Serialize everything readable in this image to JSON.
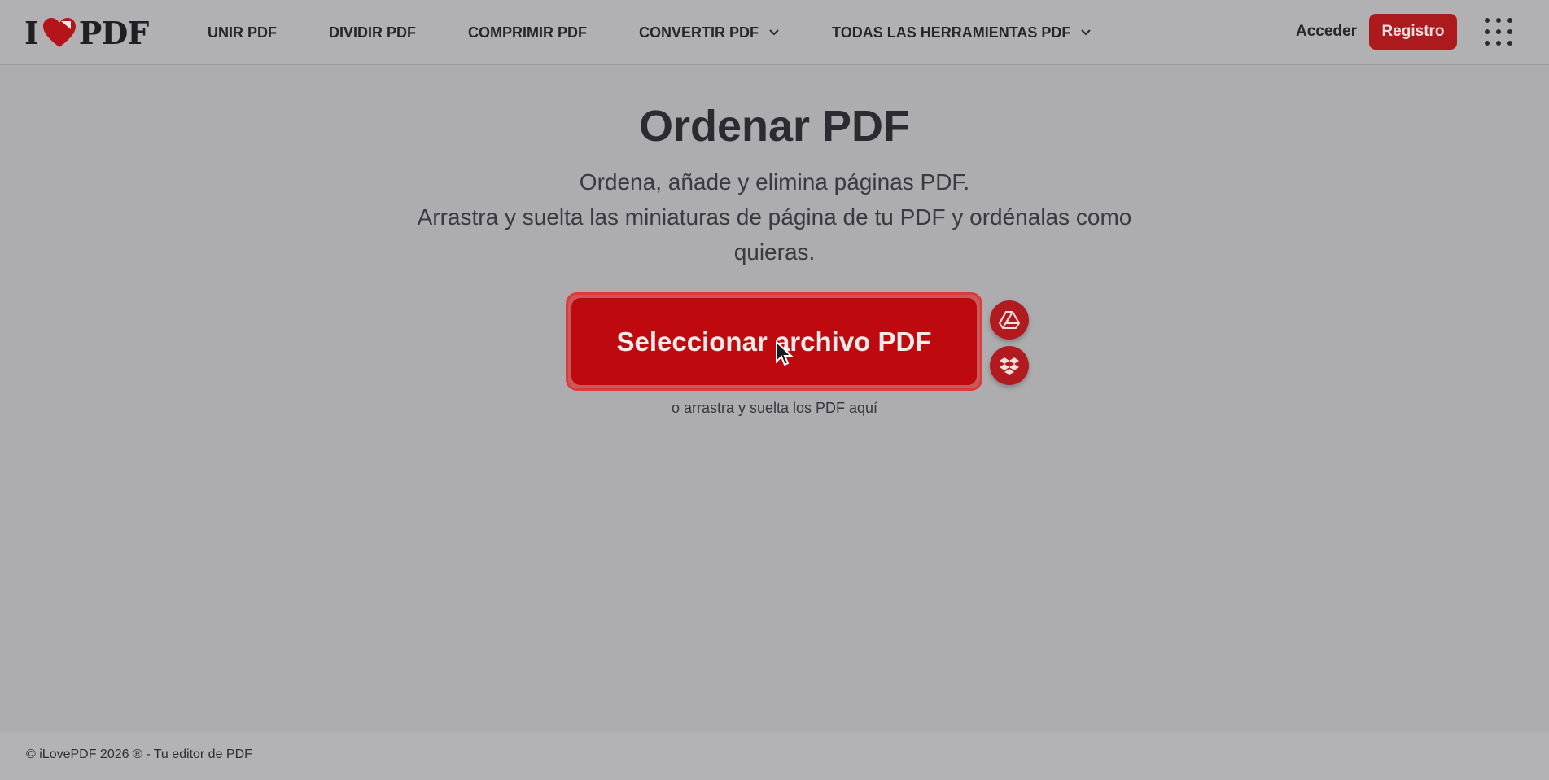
{
  "brand": {
    "logo_left": "I",
    "logo_right": "PDF",
    "accent": "#be0a0f"
  },
  "nav": {
    "items": [
      {
        "label": "UNIR PDF",
        "has_dropdown": false
      },
      {
        "label": "DIVIDIR PDF",
        "has_dropdown": false
      },
      {
        "label": "COMPRIMIR PDF",
        "has_dropdown": false
      },
      {
        "label": "CONVERTIR PDF",
        "has_dropdown": true
      },
      {
        "label": "TODAS LAS HERRAMIENTAS PDF",
        "has_dropdown": true
      }
    ],
    "login_label": "Acceder",
    "register_label": "Registro",
    "apps_icon": "grid-icon"
  },
  "main": {
    "title": "Ordenar PDF",
    "subtitle_line1": "Ordena, añade y elimina páginas PDF.",
    "subtitle_line2": "Arrastra y suelta las miniaturas de página de tu PDF y ordénalas como quieras.",
    "select_button": "Seleccionar archivo PDF",
    "drop_hint": "o arrastra y suelta los PDF aquí",
    "cloud_icons": [
      "google-drive-icon",
      "dropbox-icon"
    ]
  },
  "footer": {
    "copyright": "© iLovePDF 2026 ® - Tu editor de PDF"
  }
}
